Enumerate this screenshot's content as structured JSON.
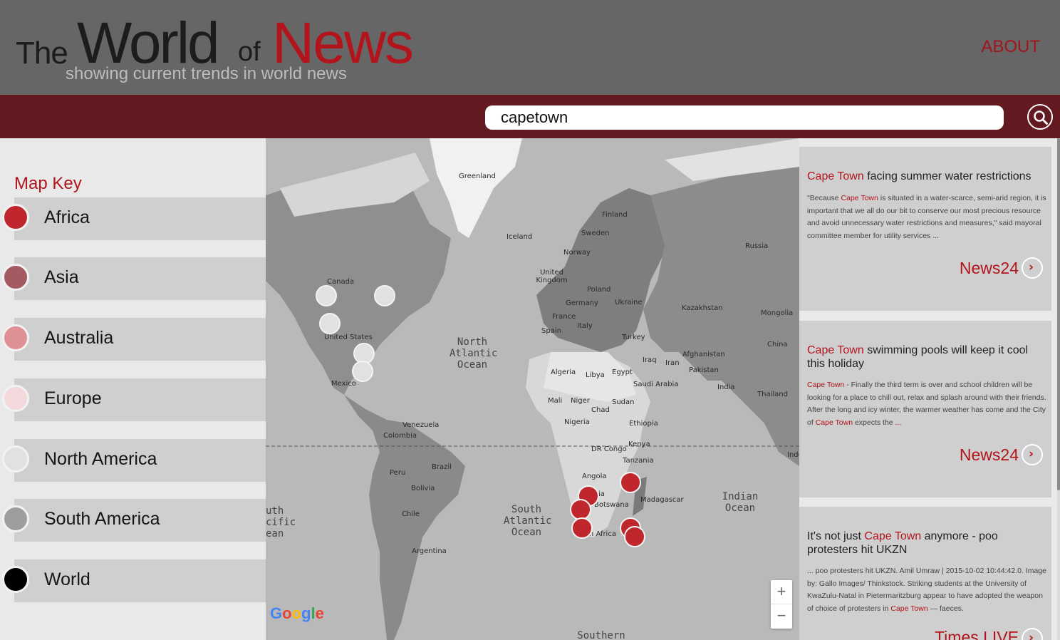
{
  "header": {
    "logo": {
      "the": "The",
      "world": "World",
      "of": "of",
      "news": "News",
      "tagline": "showing current trends in world news"
    },
    "about_label": "ABOUT"
  },
  "search": {
    "value": "capetown",
    "button_icon": "search-icon"
  },
  "map_key": {
    "title": "Map Key",
    "items": [
      {
        "label": "Africa",
        "color": "#c0272d"
      },
      {
        "label": "Asia",
        "color": "#a35a60"
      },
      {
        "label": "Australia",
        "color": "#df9097"
      },
      {
        "label": "Europe",
        "color": "#f4d9dc"
      },
      {
        "label": "North America",
        "color": "#e1e1e1"
      },
      {
        "label": "South America",
        "color": "#9d9d9d"
      },
      {
        "label": "World",
        "color": "#000000"
      }
    ]
  },
  "map": {
    "labels": [
      "Greenland",
      "Iceland",
      "Finland",
      "Sweden",
      "Norway",
      "Russia",
      "United Kingdom",
      "Poland",
      "Germany",
      "Ukraine",
      "France",
      "Italy",
      "Spain",
      "Kazakhstan",
      "Mongolia",
      "Turkey",
      "Afghanistan",
      "Iraq",
      "Iran",
      "Pakistan",
      "China",
      "India",
      "Thailand",
      "Algeria",
      "Libya",
      "Egypt",
      "Saudi Arabia",
      "Mali",
      "Niger",
      "Chad",
      "Sudan",
      "Nigeria",
      "Ethiopia",
      "DR Congo",
      "Kenya",
      "Tanzania",
      "Angola",
      "Madagascar",
      "Botswana",
      "Canada",
      "United States",
      "Mexico",
      "Venezuela",
      "Colombia",
      "Peru",
      "Brazil",
      "Bolivia",
      "Chile",
      "Argentina"
    ],
    "oceans": {
      "north_atlantic": "North Atlantic Ocean",
      "south_atlantic": "South Atlantic Ocean",
      "indian": "Indian Ocean",
      "south_pacific": "uth cific ean",
      "southern": "Southern"
    },
    "partial_labels": {
      "south_africa": "th Africa",
      "namibia": "ia",
      "indo": "Indo"
    },
    "zoom_in": "+",
    "zoom_out": "−",
    "attribution": "Google"
  },
  "news": [
    {
      "title_hl": "Cape Town",
      "title_rest": " facing summer water restrictions",
      "body_pre": "\"Because ",
      "body_hl": "Cape Town",
      "body_post": " is situated in a water-scarce, semi-arid region, it is important that we all do our bit to conserve our most precious resource and avoid unnecessary water restrictions and measures,\" said mayoral committee member for utility services ...",
      "source": "News24"
    },
    {
      "title_hl": "Cape Town",
      "title_rest": " swimming pools will keep it cool this holiday",
      "body_hl1": "Cape Town",
      "body_mid": " - Finally the third term is over and school children will be looking for a place to chill out, relax and splash around with their friends. After the long and icy winter, the warmer weather has come and the City of ",
      "body_hl2": "Cape Town",
      "body_post": " expects the ",
      "body_ellipsis": "...",
      "source": "News24"
    },
    {
      "title_pre": "It's not just ",
      "title_hl": "Cape Town",
      "title_rest": " anymore - poo protesters hit UKZN",
      "body_pre": "... poo protesters hit UKZN. Amil Umraw | 2015-10-02 10:44:42.0. Image by: Gallo Images/ Thinkstock. Striking students at the University of KwaZulu-Natal in Pietermaritzburg appear to have adopted the weapon of choice of protesters in ",
      "body_hl": "Cape Town",
      "body_post": " — faeces.",
      "source": "Times LIVE"
    }
  ]
}
